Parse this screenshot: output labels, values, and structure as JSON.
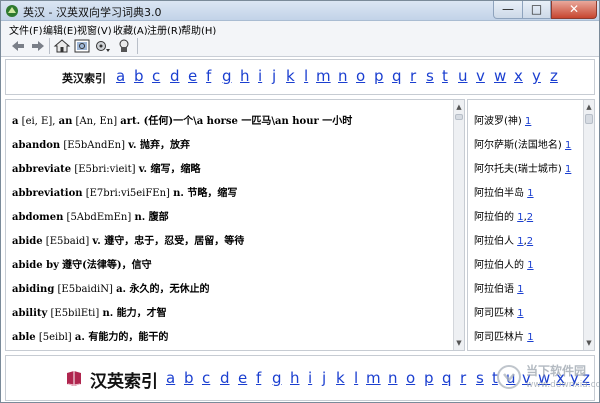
{
  "window": {
    "title": "英汉 - 汉英双向学习词典3.0",
    "min": "—",
    "max": "□",
    "close": "✕"
  },
  "menu": [
    "文件(F)",
    "编辑(E)",
    "视窗(V)",
    "收藏(A)",
    "注册(R)",
    "帮助(H)"
  ],
  "toolbar_icons": [
    "back-arrow-icon",
    "forward-arrow-icon",
    "home-icon",
    "dictionary-search-icon",
    "settings-dropdown-icon",
    "bookmark-icon"
  ],
  "top_index": {
    "label": "英汉索引",
    "letters": [
      "a",
      "b",
      "c",
      "d",
      "e",
      "f",
      "g",
      "h",
      "i",
      "j",
      "k",
      "l",
      "m",
      "n",
      "o",
      "p",
      "q",
      "r",
      "s",
      "t",
      "u",
      "v",
      "w",
      "x",
      "y",
      "z"
    ]
  },
  "entries": [
    {
      "hw": "a",
      "ph": " [ei, E], ",
      "hw2": "an",
      "ph2": " [An, En] ",
      "df": "art. (任何)一个\\a horse 一匹马\\an hour 一小时"
    },
    {
      "hw": "abandon",
      "ph": " [E5bAndEn] ",
      "hw2": "",
      "ph2": "",
      "df": "v. 抛弃，放弃"
    },
    {
      "hw": "abbreviate",
      "ph": " [E5bri:vieit] ",
      "hw2": "",
      "ph2": "",
      "df": "v. 缩写，缩略"
    },
    {
      "hw": "abbreviation",
      "ph": " [E7bri:vi5eiFEn] ",
      "hw2": "",
      "ph2": "",
      "df": "n. 节略，缩写"
    },
    {
      "hw": "abdomen",
      "ph": " [5AbdEmEn] ",
      "hw2": "",
      "ph2": "",
      "df": "n. 腹部"
    },
    {
      "hw": "abide",
      "ph": " [E5baid] ",
      "hw2": "",
      "ph2": "",
      "df": "v. 遵守，忠于，忍受，居留，等待"
    },
    {
      "hw": "abide by",
      "ph": " ",
      "hw2": "",
      "ph2": "",
      "df": "遵守(法律等)，信守"
    },
    {
      "hw": "abiding",
      "ph": " [E5baidiN] ",
      "hw2": "",
      "ph2": "",
      "df": "a. 永久的，无休止的"
    },
    {
      "hw": "ability",
      "ph": " [E5bilEti] ",
      "hw2": "",
      "ph2": "",
      "df": "n. 能力，才智"
    },
    {
      "hw": "able",
      "ph": " [5eibl] ",
      "hw2": "",
      "ph2": "",
      "df": "a. 有能力的，能干的"
    }
  ],
  "side_items": [
    {
      "text": "阿波罗(神) ",
      "links": [
        "1"
      ]
    },
    {
      "text": "阿尔萨斯(法国地名) ",
      "links": [
        "1"
      ]
    },
    {
      "text": "阿尔托夫(瑞士城市) ",
      "links": [
        "1"
      ]
    },
    {
      "text": "阿拉伯半岛 ",
      "links": [
        "1"
      ]
    },
    {
      "text": "阿拉伯的 ",
      "links": [
        "1",
        "2"
      ]
    },
    {
      "text": "阿拉伯人 ",
      "links": [
        "1",
        "2"
      ]
    },
    {
      "text": "阿拉伯人的 ",
      "links": [
        "1"
      ]
    },
    {
      "text": "阿拉伯语 ",
      "links": [
        "1"
      ]
    },
    {
      "text": "阿司匹林 ",
      "links": [
        "1"
      ]
    },
    {
      "text": "阿司匹林片 ",
      "links": [
        "1"
      ]
    }
  ],
  "bottom_index": {
    "label": "汉英索引",
    "letters": [
      "a",
      "b",
      "c",
      "d",
      "e",
      "f",
      "g",
      "h",
      "i",
      "j",
      "k",
      "l",
      "m",
      "n",
      "o",
      "p",
      "q",
      "r",
      "s",
      "t",
      "u",
      "v",
      "w",
      "x",
      "y",
      "z"
    ]
  },
  "watermark": {
    "text": "当下软件园",
    "url": "www.downxia.com"
  },
  "colors": {
    "link": "#1b3fd0",
    "border": "#c7ccd3",
    "title_bar": "#c2d3e8"
  }
}
